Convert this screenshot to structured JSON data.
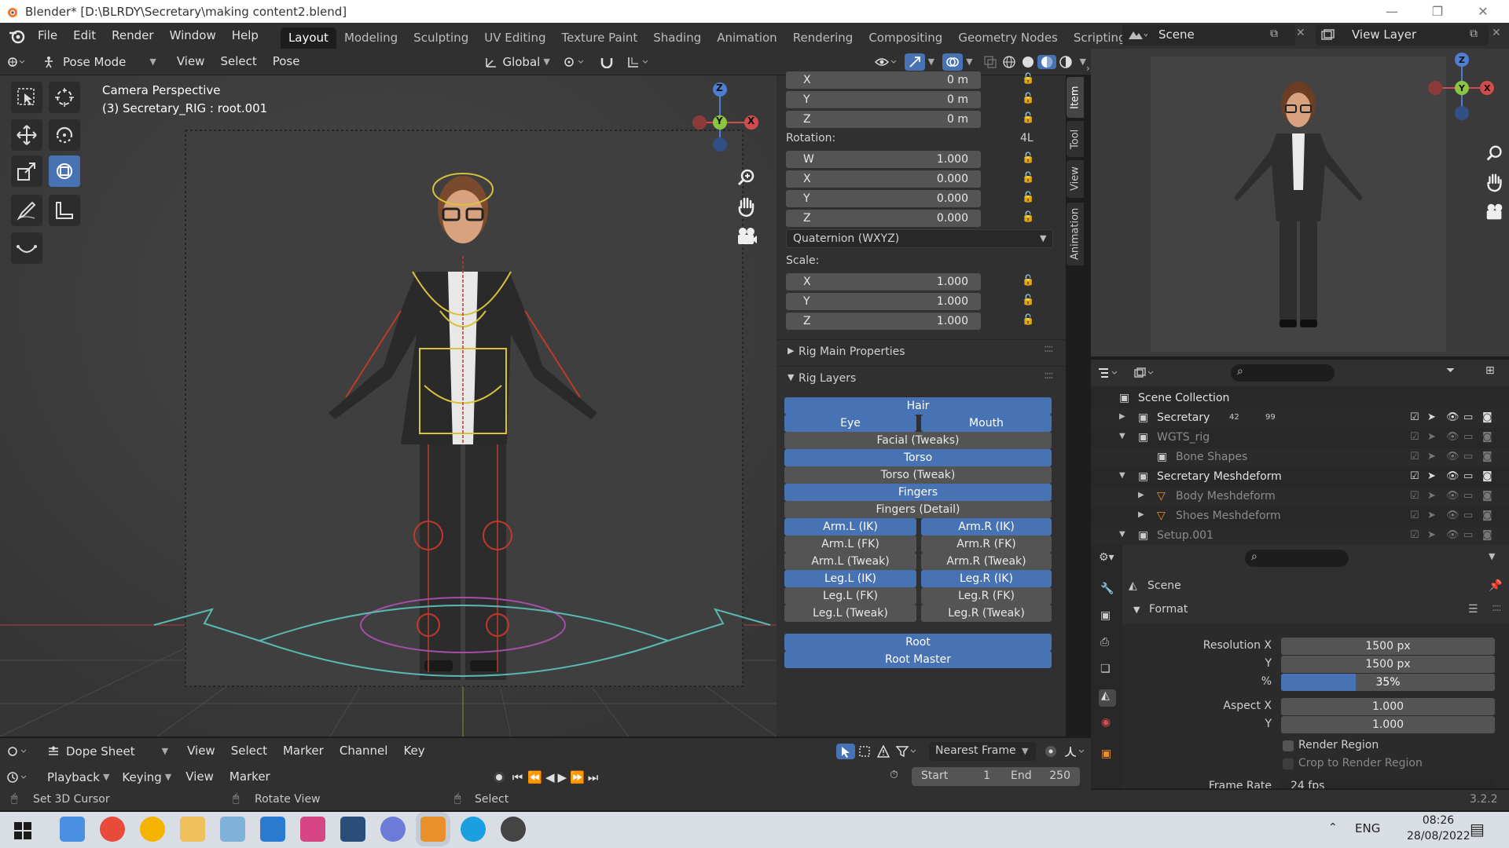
{
  "window": {
    "title": "Blender* [D:\\BLRDY\\Secretary\\making content2.blend]"
  },
  "menubar": {
    "menus": [
      "File",
      "Edit",
      "Render",
      "Window",
      "Help"
    ],
    "workspaces": [
      "Layout",
      "Modeling",
      "Sculpting",
      "UV Editing",
      "Texture Paint",
      "Shading",
      "Animation",
      "Rendering",
      "Compositing",
      "Geometry Nodes",
      "Scripting"
    ],
    "active_workspace": "Layout",
    "add_label": "+",
    "scene_label": "Scene",
    "view_layer_label": "View Layer"
  },
  "viewport_header": {
    "mode": "Pose Mode",
    "menus": [
      "View",
      "Select",
      "Pose"
    ],
    "orientation": "Global"
  },
  "viewport": {
    "overlay_title": "Camera Perspective",
    "overlay_subtitle": "(3) Secretary_RIG : root.001",
    "gizmo": {
      "z": "Z",
      "y": "Y",
      "x": "X"
    }
  },
  "n_panel": {
    "tabs": [
      "Item",
      "Tool",
      "View",
      "Animation"
    ],
    "active_tab": "Item",
    "location": [
      {
        "axis": "X",
        "value": "0 m"
      },
      {
        "axis": "Y",
        "value": "0 m"
      },
      {
        "axis": "Z",
        "value": "0 m"
      }
    ],
    "rotation_label": "Rotation:",
    "rotation_mode_short": "4L",
    "rotation": [
      {
        "axis": "W",
        "value": "1.000"
      },
      {
        "axis": "X",
        "value": "0.000"
      },
      {
        "axis": "Y",
        "value": "0.000"
      },
      {
        "axis": "Z",
        "value": "0.000"
      }
    ],
    "rotation_mode": "Quaternion (WXYZ)",
    "scale_label": "Scale:",
    "scale": [
      {
        "axis": "X",
        "value": "1.000"
      },
      {
        "axis": "Y",
        "value": "1.000"
      },
      {
        "axis": "Z",
        "value": "1.000"
      }
    ],
    "rig_main_properties": "Rig Main Properties",
    "rig_layers": "Rig Layers",
    "rig_buttons": [
      {
        "label": "Hair",
        "on": true
      },
      {
        "label": "Eye",
        "on": true
      },
      {
        "label": "Mouth",
        "on": true
      },
      {
        "label": "Facial (Tweaks)",
        "on": false
      },
      {
        "label": "Torso",
        "on": true
      },
      {
        "label": "Torso (Tweak)",
        "on": false
      },
      {
        "label": "Fingers",
        "on": true
      },
      {
        "label": "Fingers (Detail)",
        "on": false
      },
      {
        "label": "Arm.L (IK)",
        "on": true
      },
      {
        "label": "Arm.R (IK)",
        "on": true
      },
      {
        "label": "Arm.L (FK)",
        "on": false
      },
      {
        "label": "Arm.R (FK)",
        "on": false
      },
      {
        "label": "Arm.L (Tweak)",
        "on": false
      },
      {
        "label": "Arm.R (Tweak)",
        "on": false
      },
      {
        "label": "Leg.L (IK)",
        "on": true
      },
      {
        "label": "Leg.R (IK)",
        "on": true
      },
      {
        "label": "Leg.L (FK)",
        "on": false
      },
      {
        "label": "Leg.R (FK)",
        "on": false
      },
      {
        "label": "Leg.L (Tweak)",
        "on": false
      },
      {
        "label": "Leg.R (Tweak)",
        "on": false
      },
      {
        "label": "Root",
        "on": true
      },
      {
        "label": "Root Master",
        "on": true
      }
    ]
  },
  "dopesheet": {
    "editor": "Dope Sheet",
    "menus": [
      "View",
      "Select",
      "Marker",
      "Channel",
      "Key"
    ],
    "snap": "Nearest Frame"
  },
  "timeline": {
    "menus": [
      "Playback",
      "Keying",
      "View",
      "Marker"
    ],
    "current_frame": "3",
    "start_label": "Start",
    "start": "1",
    "end_label": "End",
    "end": "250"
  },
  "statusbar": {
    "items": [
      "Set 3D Cursor",
      "Rotate View",
      "Select"
    ],
    "version": "3.2.2"
  },
  "outliner": {
    "root": "Scene Collection",
    "items": [
      {
        "label": "Secretary",
        "badge1": "42",
        "badge2": "99",
        "dim": false
      },
      {
        "label": "WGTS_rig",
        "dim": true
      },
      {
        "label": "Bone Shapes",
        "dim": true
      },
      {
        "label": "Secretary Meshdeform",
        "dim": false
      },
      {
        "label": "Body Meshdeform",
        "dim": true
      },
      {
        "label": "Shoes Meshdeform",
        "dim": true
      },
      {
        "label": "Setup.001",
        "dim": true
      }
    ]
  },
  "properties": {
    "context": "Scene",
    "section": "Format",
    "resolution_x_label": "Resolution X",
    "resolution_x": "1500 px",
    "resolution_y_label": "Y",
    "resolution_y": "1500 px",
    "percent_label": "%",
    "percent": "35%",
    "percent_fraction": 0.35,
    "aspect_x_label": "Aspect X",
    "aspect_x": "1.000",
    "aspect_y_label": "Y",
    "aspect_y": "1.000",
    "render_region": "Render Region",
    "crop_region": "Crop to Render Region",
    "frame_rate_label": "Frame Rate",
    "frame_rate": "24 fps"
  },
  "taskbar": {
    "language": "ENG",
    "time": "08:26",
    "date": "28/08/2022",
    "apps": [
      "windows",
      "chrome-alt",
      "chrome",
      "file-explorer",
      "notepad",
      "vscode",
      "instagram",
      "photoshop",
      "discord",
      "blender",
      "skype",
      "clock"
    ]
  },
  "colors": {
    "accent": "#4772b3",
    "button": "#545454",
    "panel": "#303030",
    "viewport": "#3d3d3d"
  }
}
